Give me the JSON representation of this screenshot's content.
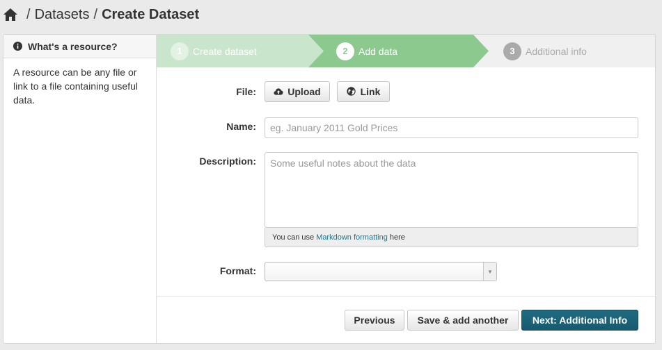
{
  "breadcrumb": {
    "items": [
      "Datasets"
    ],
    "current": "Create Dataset",
    "separator": "/"
  },
  "aside": {
    "title": "What's a resource?",
    "body": "A resource can be any file or link to a file containing useful data."
  },
  "stages": [
    {
      "number": "1",
      "label": "Create dataset",
      "state": "complete"
    },
    {
      "number": "2",
      "label": "Add data",
      "state": "active"
    },
    {
      "number": "3",
      "label": "Additional info",
      "state": "upcoming"
    }
  ],
  "form": {
    "file_label": "File:",
    "upload_label": "Upload",
    "link_label": "Link",
    "name_label": "Name:",
    "name_placeholder": "eg. January 2011 Gold Prices",
    "name_value": "",
    "description_label": "Description:",
    "description_placeholder": "Some useful notes about the data",
    "description_value": "",
    "markdown_prefix": "You can use",
    "markdown_link": "Markdown formatting",
    "markdown_suffix": "here",
    "format_label": "Format:",
    "format_value": ""
  },
  "actions": {
    "previous": "Previous",
    "save_add_another": "Save & add another",
    "next": "Next: Additional Info"
  },
  "colors": {
    "stage_complete": "#c9e6cd",
    "stage_active": "#8cc98f",
    "primary_button": "#206b82",
    "link": "#187794"
  },
  "icons": {
    "home": "home-icon",
    "info": "info-circle-icon",
    "upload": "cloud-upload-icon",
    "link": "globe-icon",
    "dropdown": "caret-down-icon"
  }
}
